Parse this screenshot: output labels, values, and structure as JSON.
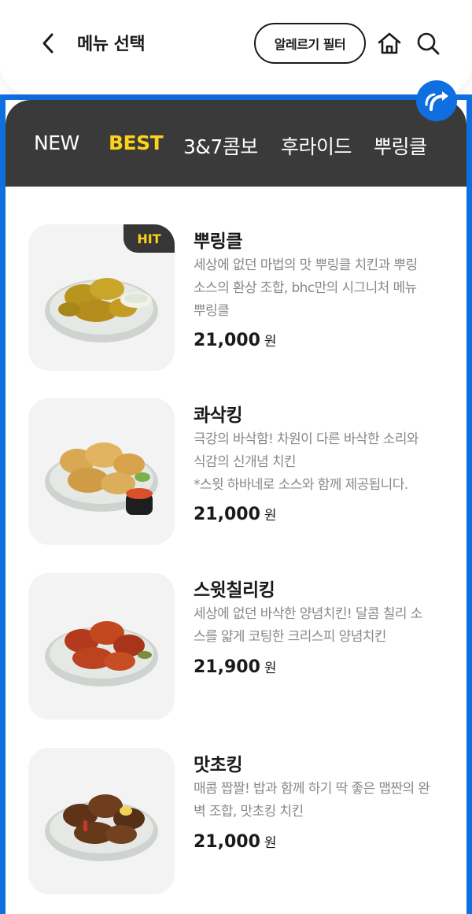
{
  "header": {
    "title": "메뉴 선택",
    "allergy_filter_label": "알레르기 필터"
  },
  "tabs": [
    {
      "label": "NEW",
      "active": false
    },
    {
      "label": "BEST",
      "active": true
    },
    {
      "label": "3&7콤보",
      "active": false
    },
    {
      "label": "후라이드",
      "active": false
    },
    {
      "label": "뿌링클",
      "active": false
    }
  ],
  "menu": {
    "items": [
      {
        "name": "뿌링클",
        "badge": "HIT",
        "desc_lines": [
          "세상에 없던 마법의 맛 뿌링클 치킨과 뿌링",
          "소스의 환상 조합, bhc만의 시그니처 메뉴",
          "뿌링클"
        ],
        "price": "21,000",
        "currency": "원"
      },
      {
        "name": "콰삭킹",
        "badge": "",
        "desc_lines": [
          "극강의 바삭함! 차원이 다른 바삭한 소리와",
          "식감의 신개념 치킨",
          "*스윗 하바네로 소스와 함께 제공됩니다."
        ],
        "price": "21,000",
        "currency": "원"
      },
      {
        "name": "스윗칠리킹",
        "badge": "",
        "desc_lines": [
          "세상에 없던 바삭한 양념치킨! 달콤 칠리 소",
          "스를 얇게 코팅한 크리스피 양념치킨"
        ],
        "price": "21,900",
        "currency": "원"
      },
      {
        "name": "맛초킹",
        "badge": "",
        "desc_lines": [
          "매콤 짭짤! 밥과 함께 하기 딱 좋은 맵짠의 완",
          "벽 조합, 맛초킹 치킨"
        ],
        "price": "21,000",
        "currency": "원"
      }
    ]
  },
  "colors": {
    "accent_blue": "#0f6fe0",
    "tab_bar_bg": "#3a3a3a",
    "active_tab": "#ffd21a",
    "thumb_bg": "#f3f3f3"
  },
  "icons": {
    "back": "chevron-left-icon",
    "home": "home-icon",
    "search": "search-icon",
    "fab": "return-arrow-icon"
  }
}
